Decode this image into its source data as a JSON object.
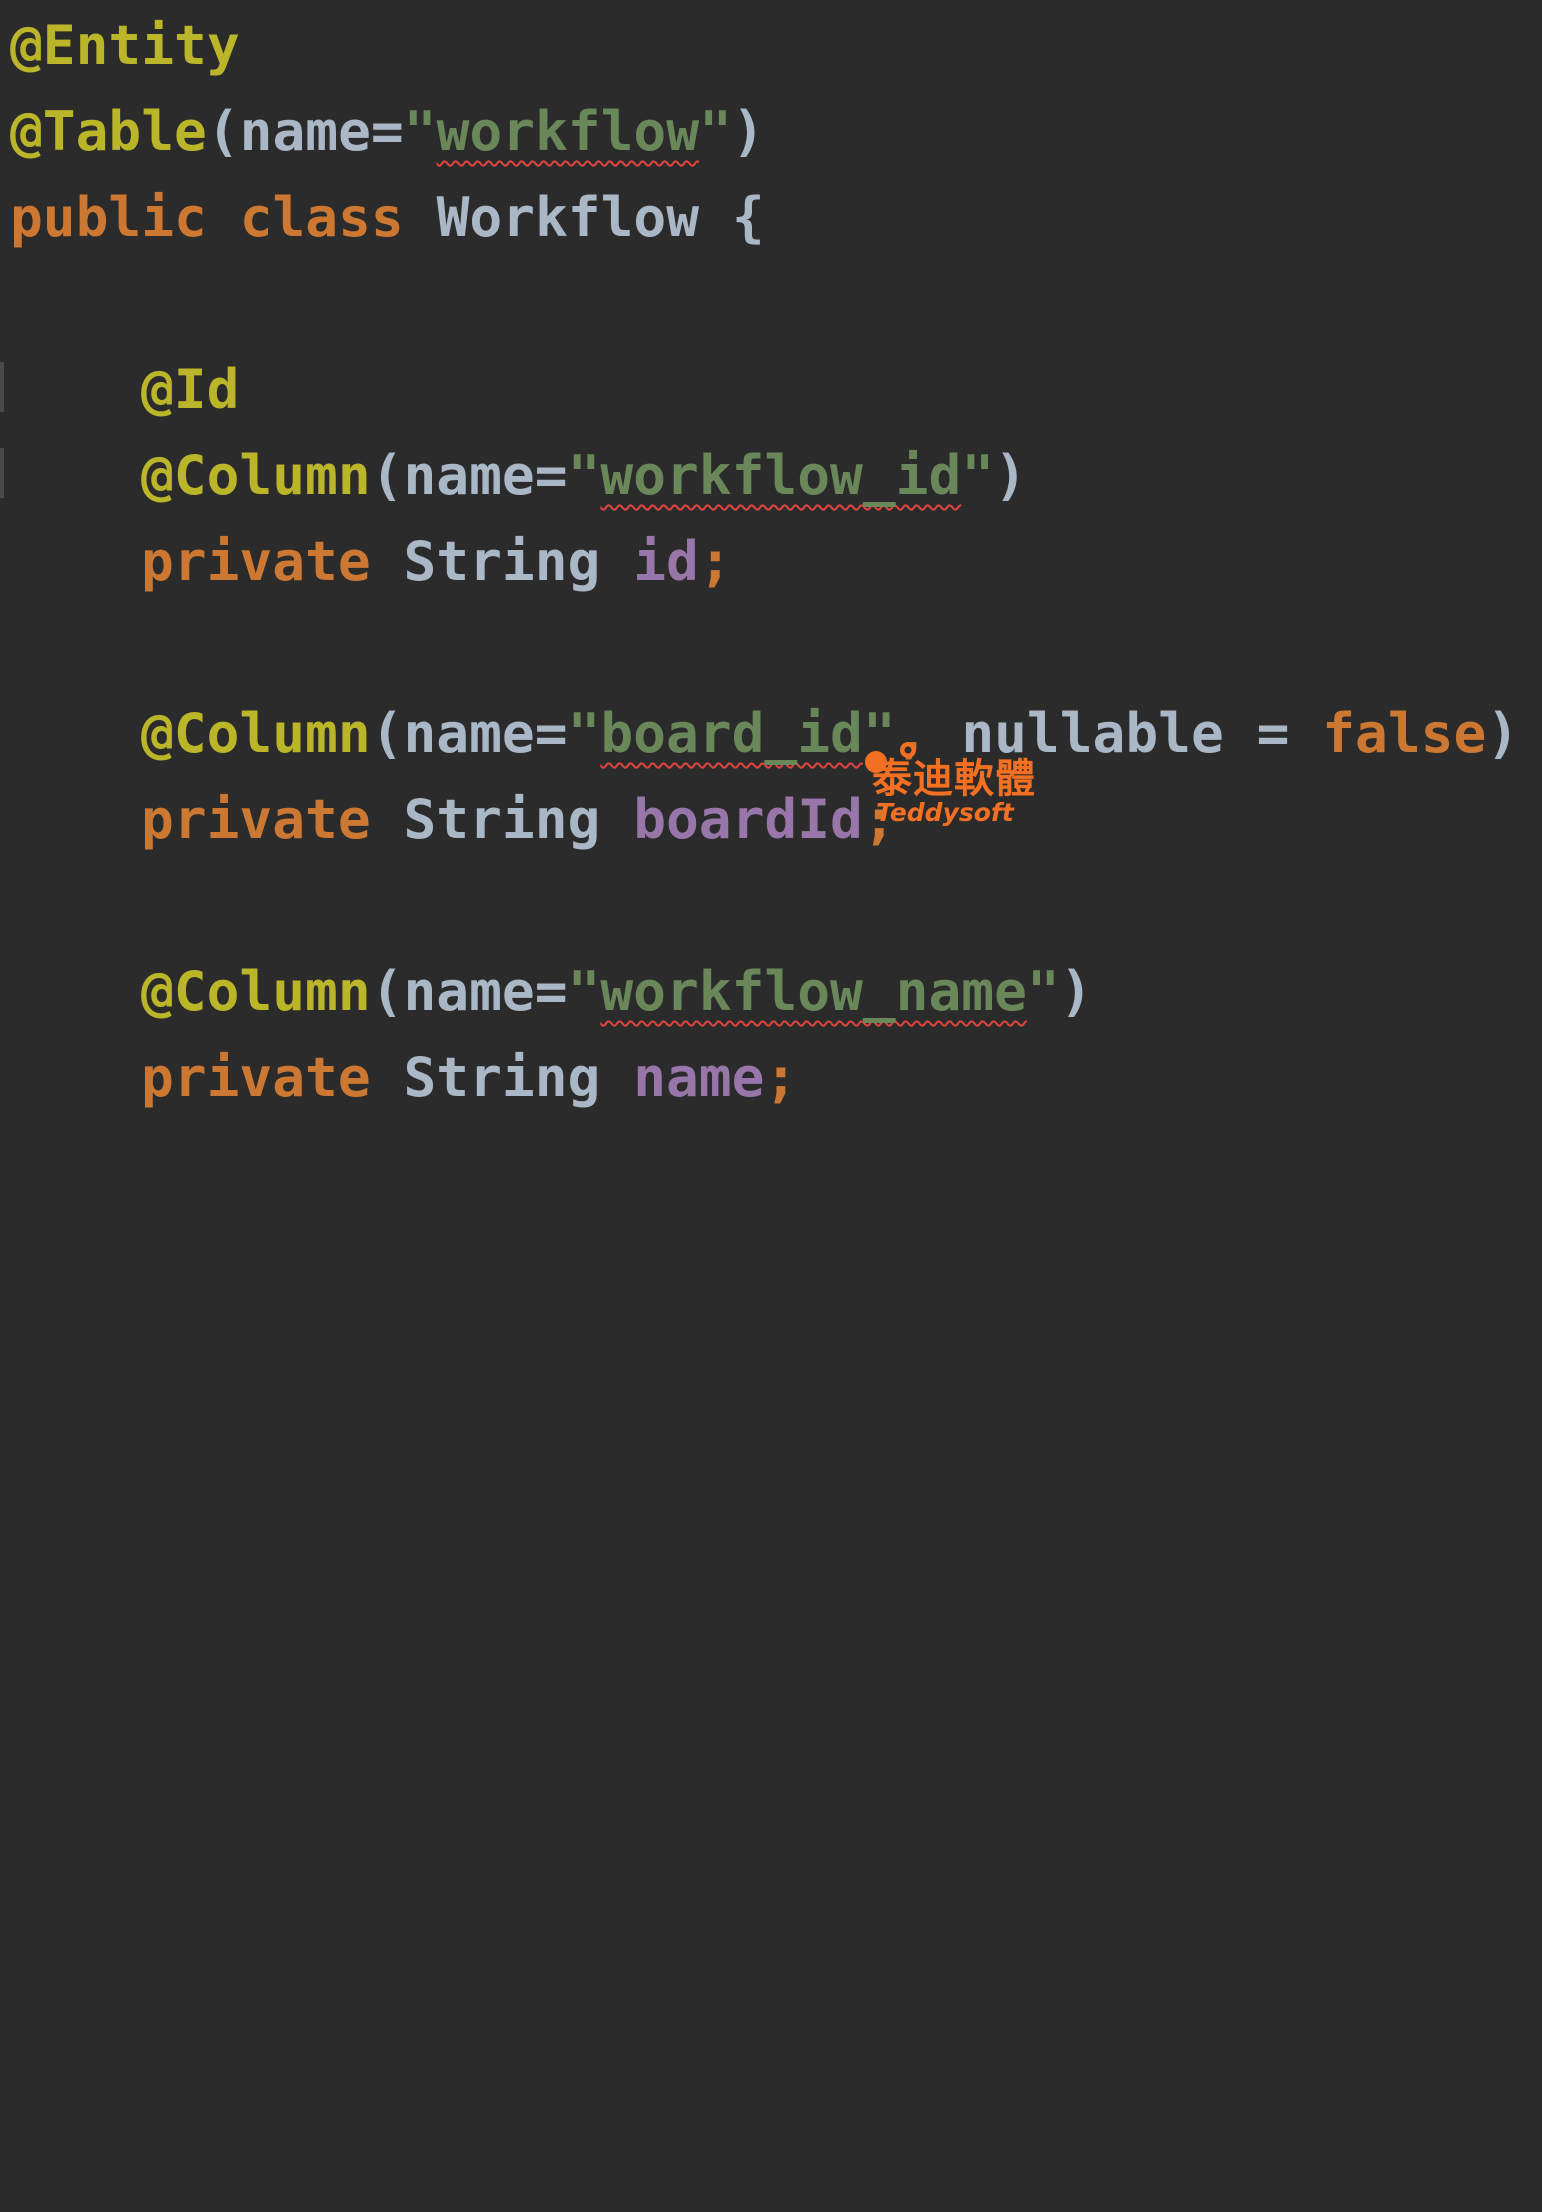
{
  "editor": {
    "theme_colors": {
      "background": "#2b2b2b",
      "annotation": "#bbb529",
      "keyword": "#cc7832",
      "plain": "#a9b7c6",
      "string": "#6a8759",
      "field": "#9876aa",
      "typo_underline": "#e0443e"
    },
    "lines": {
      "l1": {
        "annotation": "@Entity"
      },
      "l2": {
        "annotation": "@Table",
        "open": "(name=",
        "quote_open": "\"",
        "value": "workflow",
        "quote_close": "\"",
        "close": ")"
      },
      "l3": {
        "kw1": "public",
        "kw2": "class",
        "name": "Workflow",
        "brace": "{"
      },
      "l5": {
        "annotation": "@Id"
      },
      "l6": {
        "annotation": "@Column",
        "open": "(name=",
        "quote_open": "\"",
        "value": "workflow_id",
        "quote_close": "\"",
        "close": ")"
      },
      "l7": {
        "kw": "private",
        "type": "String",
        "field": "id",
        "semi": ";"
      },
      "l9": {
        "annotation": "@Column",
        "open": "(name=",
        "quote_open": "\"",
        "value": "board_id",
        "quote_close": "\"",
        "comma": ",",
        "param": "nullable",
        "eq": "=",
        "literal": "false",
        "close": ")"
      },
      "l10": {
        "kw": "private",
        "type": "String",
        "field": "boardId",
        "semi": ";"
      },
      "l12": {
        "annotation": "@Column",
        "open": "(name=",
        "quote_open": "\"",
        "value": "workflow_name",
        "quote_close": "\"",
        "close": ")"
      },
      "l13": {
        "kw": "private",
        "type": "String",
        "field": "name",
        "semi": ";"
      }
    }
  },
  "watermark": {
    "brand_cn": "泰迪軟體",
    "brand_en": "Teddysoft",
    "color": "#f36f21"
  }
}
